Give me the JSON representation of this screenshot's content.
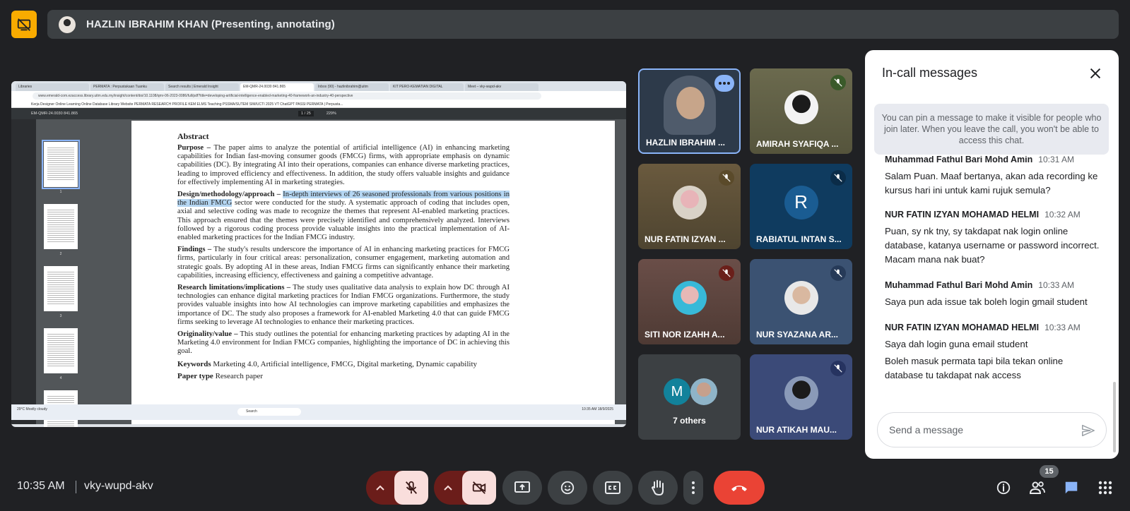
{
  "presenter": {
    "label": "HAZLIN IBRAHIM KHAN (Presenting, annotating)"
  },
  "shared_screen": {
    "tabs": [
      "Libraries",
      "PERMATA : Perpustakaan Tuanku",
      "Search results | Emerald Insight",
      "EM-QMR-24.0030 841.865",
      "Inbox (90) - hazlinibrahim@uitm",
      "KIT PERO-KEMATIAN DIGITAL",
      "Meet – vky-wupd-akv"
    ],
    "url": "www.emerald-com.ezaccess.library.uitm.edu.my/insight/content/doi/10.1108/qmr-06-2023-0086/full/pdf?title=developing-artificial-intelligence-enabled-marketing-40-framework-an-industry-40-perspective",
    "bookmarks": "Kerja   Designer   Online Learning   Online Database   Library Website   PERMATA   RESEARCH PROFILE   KEM ELMS   Teaching   PSSMA/SUTEM   SIM/UCTI 2025   VT   ChatGPT   PASSI   PERMATA | Perpusta...",
    "pdf_title": "EM-QMR-24.0030 841.865",
    "pdf_page": "1 / 25",
    "pdf_zoom": "229%",
    "thumb_labels": [
      "1",
      "2",
      "3",
      "4"
    ],
    "abstract": {
      "heading": "Abstract",
      "purpose_label": "Purpose –",
      "purpose_text": "The paper aims to analyze the potential of artificial intelligence (AI) in enhancing marketing capabilities for Indian fast-moving consumer goods (FMCG) firms, with appropriate emphasis on dynamic capabilities (DC). By integrating AI into their operations, companies can enhance diverse marketing practices, leading to improved efficiency and effectiveness. In addition, the study offers valuable insights and guidance for effectively implementing AI in marketing strategies.",
      "design_label": "Design/methodology/approach –",
      "design_hl": "In-depth interviews of 26 seasoned professionals from various positions in the Indian FMCG",
      "design_text": "sector were conducted for the study. A systematic approach of coding that includes open, axial and selective coding was made to recognize the themes that represent AI-enabled marketing practices. This approach ensured that the themes were precisely identified and comprehensively analyzed. Interviews followed by a rigorous coding process provide valuable insights into the practical implementation of AI-enabled marketing practices for the Indian FMCG industry.",
      "findings_label": "Findings –",
      "findings_text": "The study's results underscore the importance of AI in enhancing marketing practices for FMCG firms, particularly in four critical areas: personalization, consumer engagement, marketing automation and strategic goals. By adopting AI in these areas, Indian FMCG firms can significantly enhance their marketing capabilities, increasing efficiency, effectiveness and gaining a competitive advantage.",
      "limits_label": "Research limitations/implications –",
      "limits_text": "The study uses qualitative data analysis to explain how DC through AI technologies can enhance digital marketing practices for Indian FMCG organizations. Furthermore, the study provides valuable insights into how AI technologies can improve marketing capabilities and emphasizes the importance of DC. The study also proposes a framework for AI-enabled Marketing 4.0 that can guide FMCG firms seeking to leverage AI technologies to enhance their marketing practices.",
      "orig_label": "Originality/value –",
      "orig_text": "This study outlines the potential for enhancing marketing practices by adapting AI in the Marketing 4.0 environment for Indian FMCG companies, highlighting the importance of DC in achieving this goal.",
      "keywords_label": "Keywords",
      "keywords_text": "Marketing 4.0, Artificial intelligence, FMCG, Digital marketing, Dynamic capability",
      "papertype_label": "Paper type",
      "papertype_text": "Research paper"
    },
    "taskbar": {
      "weather": "29°C Mostly cloudy",
      "search": "Search",
      "clock": "10:35 AM 18/9/2025"
    }
  },
  "participants": [
    {
      "name": "HAZLIN IBRAHIM ...",
      "muted": false,
      "speaking": true
    },
    {
      "name": "AMIRAH SYAFIQA ...",
      "muted": true
    },
    {
      "name": "NUR FATIN IZYAN ...",
      "muted": true
    },
    {
      "name": "RABIATUL INTAN S...",
      "muted": true,
      "initial": "R"
    },
    {
      "name": "SITI NOR IZAHH A...",
      "muted": true
    },
    {
      "name": "NUR SYAZANA AR...",
      "muted": true
    },
    {
      "name": "7 others",
      "initial": "M"
    },
    {
      "name": "NUR ATIKAH MAU...",
      "muted": true
    }
  ],
  "chat": {
    "title": "In-call messages",
    "pin_note": "You can pin a message to make it visible for people who join later. When you leave the call, you won't be able to access this chat.",
    "messages": [
      {
        "sender": "Muhammad Fathul Bari Mohd Amin",
        "time": "10:31 AM",
        "text": "Salam Puan. Maaf bertanya, akan ada recording ke kursus hari ini untuk kami rujuk semula?"
      },
      {
        "sender": "NUR FATIN IZYAN MOHAMAD HELMI",
        "time": "10:32 AM",
        "text": "Puan, sy nk tny, sy takdapat nak login online database, katanya username or password incorrect. Macam mana nak buat?"
      },
      {
        "sender": "Muhammad Fathul Bari Mohd Amin",
        "time": "10:33 AM",
        "text": "Saya pun ada issue tak boleh login gmail student"
      },
      {
        "sender": "NUR FATIN IZYAN MOHAMAD HELMI",
        "time": "10:33 AM",
        "text": "Saya dah login guna email student",
        "text2": "Boleh masuk permata tapi bila tekan online database tu takdapat nak access"
      }
    ],
    "input_placeholder": "Send a message"
  },
  "bottom": {
    "time": "10:35 AM",
    "meeting_code": "vky-wupd-akv",
    "participant_count": "15"
  },
  "colors": {
    "accent": "#8ab4f8",
    "end_call": "#ea4335",
    "present_yellow": "#f9ab00",
    "muted_red": "#f9dedc"
  }
}
